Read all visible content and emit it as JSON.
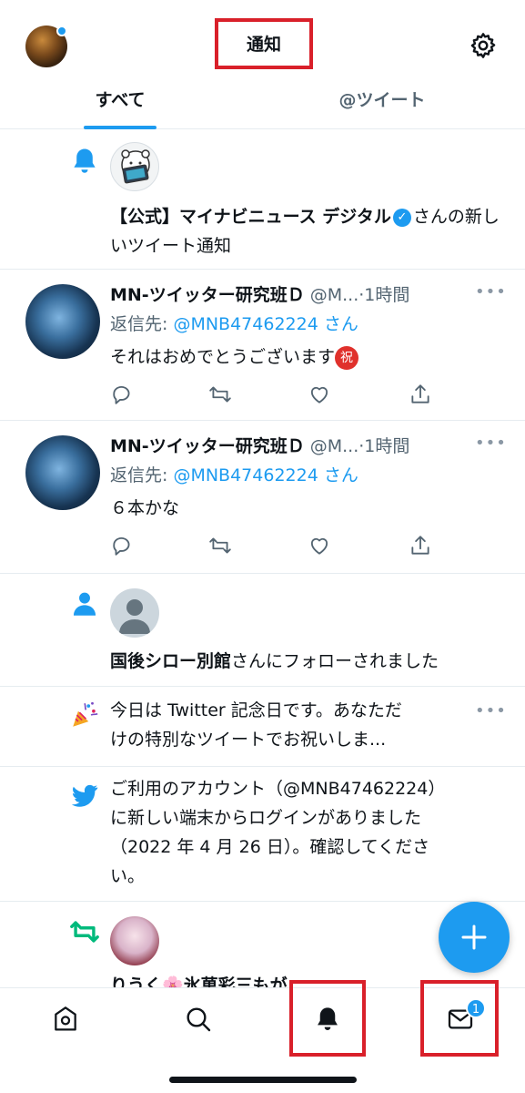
{
  "header": {
    "title": "通知",
    "settings_icon": "gear-icon"
  },
  "tabs": [
    {
      "label": "すべて",
      "active": true
    },
    {
      "label": "@ツイート",
      "active": false
    }
  ],
  "notifications": {
    "new_tweet": {
      "account": "【公式】マイナビニュース デジタル",
      "suffix": "さんの新しいツイート通知"
    },
    "tweet1": {
      "name": "MN-ツイッター研究班Ｄ",
      "handle": "@M...",
      "time": "·1時間",
      "reply_prefix": "返信先:",
      "reply_to": "@MNB47462224 さん",
      "body": "それはおめでとうございます",
      "emoji": "祝"
    },
    "tweet2": {
      "name": "MN-ツイッター研究班Ｄ",
      "handle": "@M...",
      "time": "·1時間",
      "reply_prefix": "返信先:",
      "reply_to": "@MNB47462224 さん",
      "body": "６本かな"
    },
    "follow": {
      "account": "国後シロー別館",
      "suffix": "さんにフォローされました"
    },
    "anniversary": {
      "line1": "今日は Twitter 記念日です。あなただ",
      "line2": "けの特別なツイートでお祝いしま..."
    },
    "login": {
      "line1": "ご利用のアカウント（@MNB47462224）",
      "line2": "に新しい端末からログインがありました",
      "line3": "（2022 年 4 月 26 日）。確認してくださ",
      "line4": "い。"
    },
    "retweet": {
      "partial_name": "りうく🌸氷菓彩三もが..."
    }
  },
  "bottom_nav": {
    "badge_count": "1",
    "items": [
      "home-icon",
      "search-icon",
      "notifications-icon",
      "messages-icon"
    ]
  },
  "colors": {
    "accent": "#1d9bf0",
    "highlight_box": "#d9202a",
    "retweet_green": "#00ba7c"
  }
}
